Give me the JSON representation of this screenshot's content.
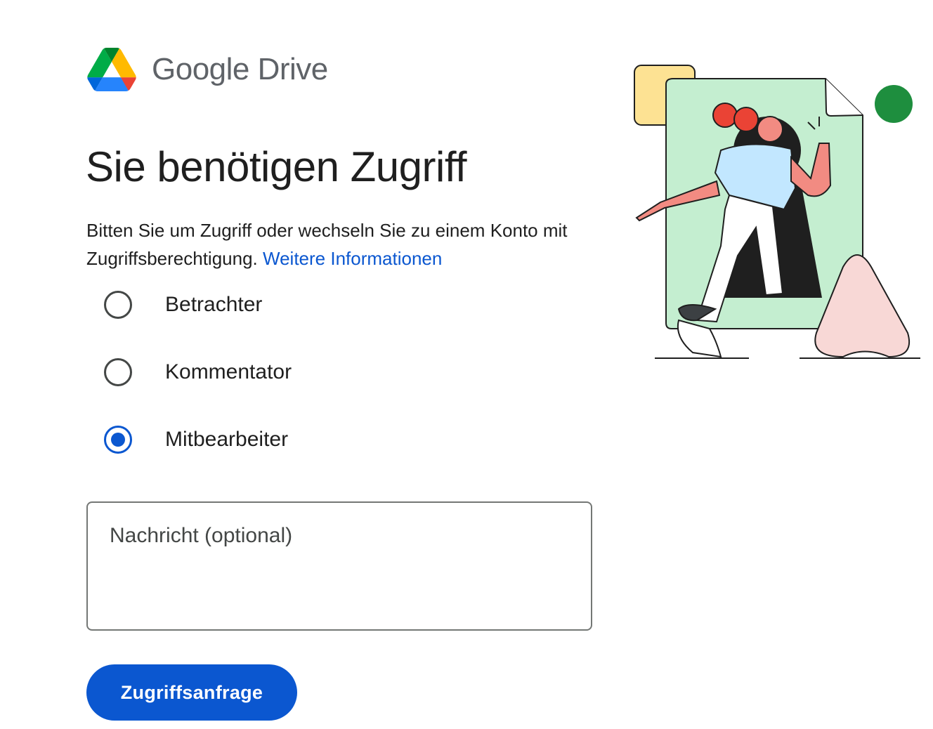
{
  "brand": {
    "name": "Google Drive",
    "logo_icon": "google-drive-logo",
    "colors": {
      "green": "#1ea362",
      "yellow": "#ffba00",
      "blue": "#4285f4",
      "red": "#db3236"
    }
  },
  "page": {
    "title": "Sie benötigen Zugriff",
    "intro": "Bitten Sie um Zugriff oder wechseln Sie zu einem Konto mit Zugriffsberechtigung.",
    "learn_more_link": "Weitere Informationen"
  },
  "roles": {
    "items": [
      {
        "label": "Betrachter",
        "selected": false
      },
      {
        "label": "Kommentator",
        "selected": false
      },
      {
        "label": "Mitbearbeiter",
        "selected": true
      }
    ]
  },
  "message": {
    "placeholder": "Nachricht (optional)",
    "value": ""
  },
  "actions": {
    "request_label": "Zugriffsanfrage"
  },
  "illustration": {
    "icon": "person-entering-keyhole-document-illustration"
  },
  "theme": {
    "accent": "#0b57d0",
    "text": "#1f1f1f",
    "muted": "#5f6368"
  }
}
